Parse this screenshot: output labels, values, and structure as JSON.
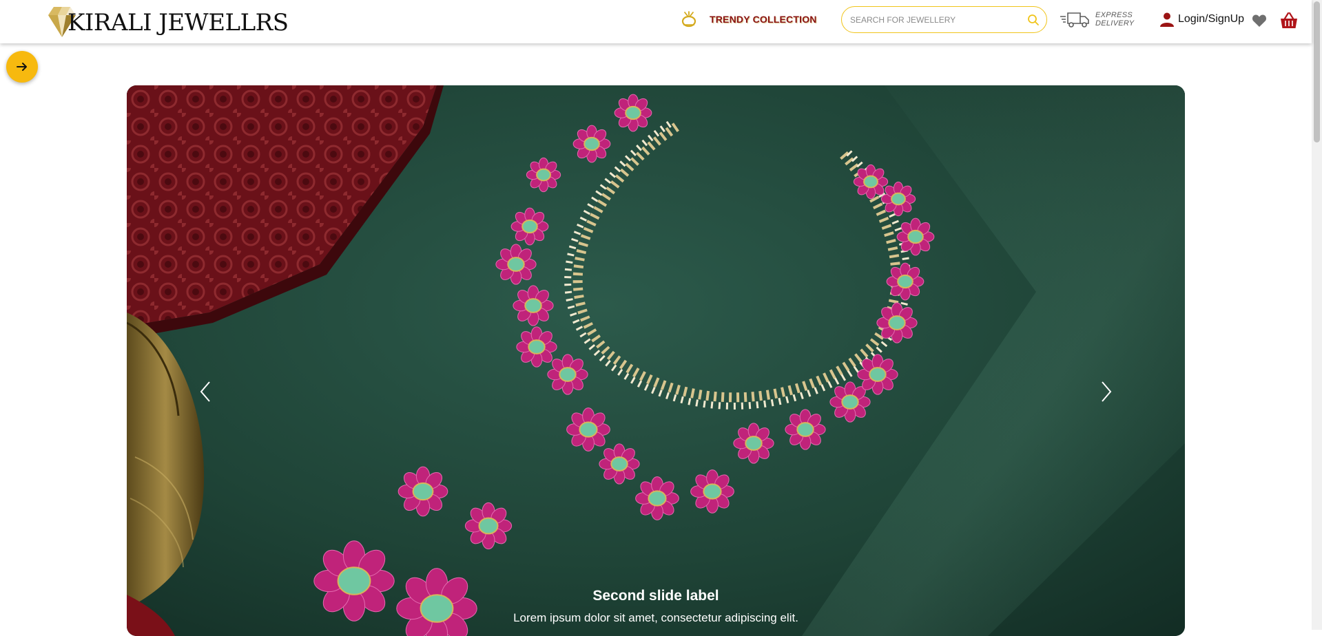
{
  "brand": {
    "name": "KIRALI JEWELLRS",
    "logo_icon": "gold-diamond-icon",
    "gold": "#d8b961",
    "gold_dark": "#9e7f2c",
    "cream": "#f3ead3"
  },
  "nav": {
    "trendy_label": "TRENDY COLLECTION",
    "trendy_icon": "ring-icon",
    "search_placeholder": "SEARCH FOR JEWELLERY",
    "search_icon": "search-icon",
    "express_line1": "EXPRESS",
    "express_line2": "DELIVERY",
    "express_icon": "delivery-truck-icon",
    "login_label": "Login/SignUp",
    "login_icon": "user-icon",
    "wishlist_icon": "heart-icon",
    "cart_icon": "basket-icon"
  },
  "colors": {
    "accent_yellow": "#f7b90f",
    "search_border": "#f0c419",
    "brand_maroon": "#8a1313",
    "carousel_green": "#1d3d33"
  },
  "fab": {
    "icon": "arrow-right-icon"
  },
  "carousel": {
    "prev_icon": "chevron-left-icon",
    "next_icon": "chevron-right-icon",
    "caption_title": "Second slide label",
    "caption_text": "Lorem ipsum dolor sit amet, consectetur adipiscing elit."
  }
}
